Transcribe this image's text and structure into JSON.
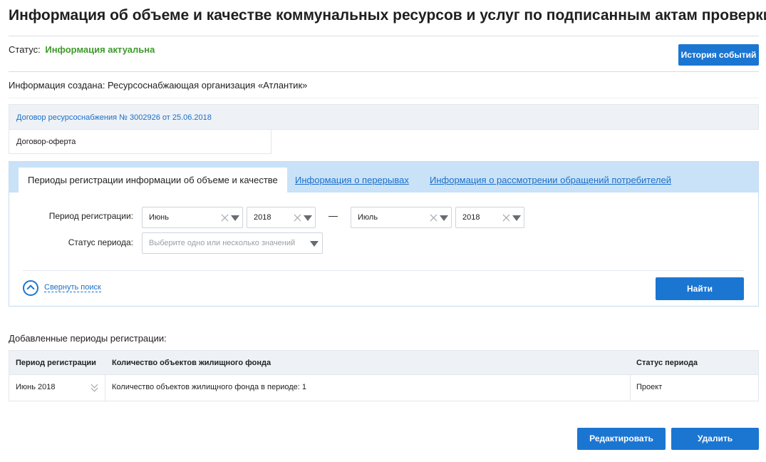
{
  "page": {
    "title": "Информация об объеме и качестве коммунальных ресурсов и услуг по подписанным актам проверки"
  },
  "status": {
    "label": "Статус:",
    "value": "Информация актуальна",
    "value_color": "#3f9a2c"
  },
  "header": {
    "history_button": "История событий",
    "created_by": "Информация создана: Ресурсоснабжающая организация «Атлантик»"
  },
  "contract": {
    "link": "Договор ресурсоснабжения № 3002926 от 25.06.2018",
    "type": "Договор-оферта"
  },
  "tabs": [
    {
      "label": "Периоды регистрации информации об объеме и качестве",
      "active": true
    },
    {
      "label": "Информация о перерывах",
      "active": false
    },
    {
      "label": "Информация о рассмотрении обращений потребителей",
      "active": false
    }
  ],
  "search": {
    "period_label": "Период регистрации:",
    "from_month": "Июнь",
    "from_year": "2018",
    "to_month": "Июль",
    "to_year": "2018",
    "status_label": "Статус периода:",
    "status_placeholder": "Выберите одно или несколько значений",
    "collapse_label": "Свернуть поиск",
    "find_button": "Найти"
  },
  "periods": {
    "title": "Добавленные периоды регистрации:",
    "columns": [
      "Период регистрации",
      "Количество объектов жилищного фонда",
      "Статус периода"
    ],
    "rows": [
      {
        "period": "Июнь 2018",
        "objects": "Количество объектов жилищного фонда в периоде: 1",
        "status": "Проект"
      }
    ]
  },
  "actions": {
    "edit_button": "Редактировать",
    "delete_button": "Удалить"
  },
  "colors": {
    "accent": "#1b76d2",
    "link": "#1b6fc8",
    "tabs_bar": "#c9e2f8"
  }
}
